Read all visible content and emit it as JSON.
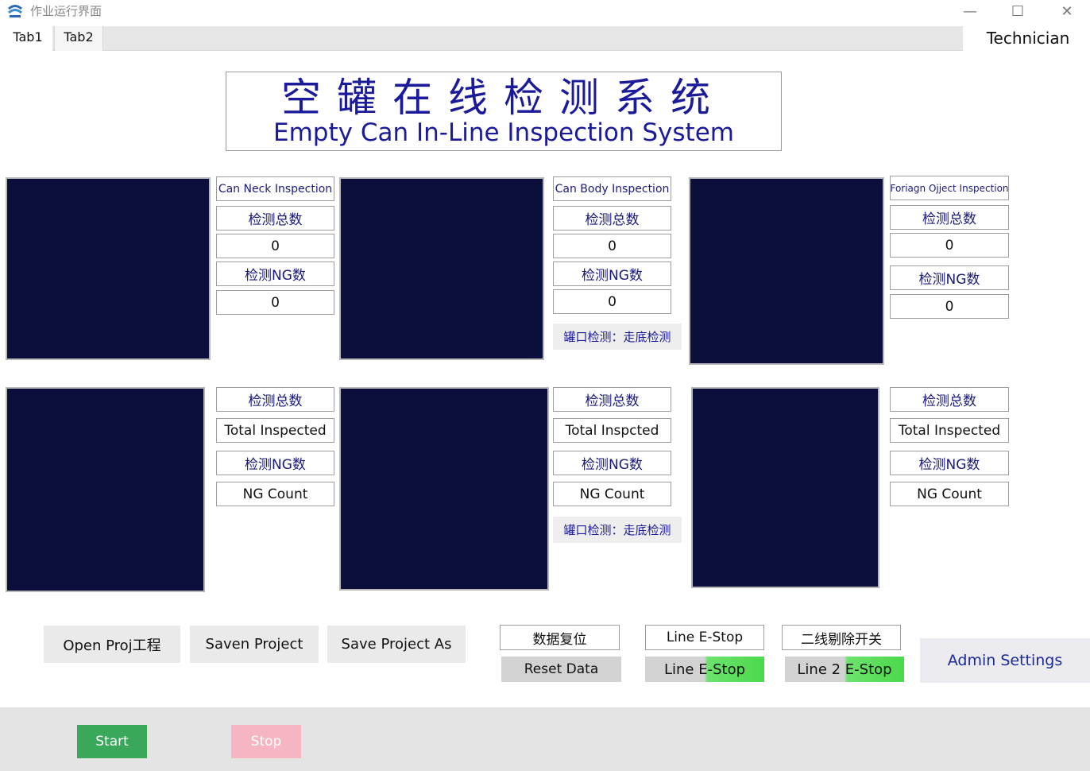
{
  "window": {
    "title": "作业运行界面",
    "minimize": "—",
    "maximize": "☐",
    "close": "✕"
  },
  "tabs": [
    "Tab1",
    "Tab2"
  ],
  "role": "Technician",
  "system_title": {
    "cn": "空罐在线检测系统",
    "en": "Empty Can In-Line Inspection System"
  },
  "top_row": [
    {
      "header": "Can Neck Inspection",
      "total_label": "检测总数",
      "total_value": "0",
      "ng_label": "检测NG数",
      "ng_value": "0"
    },
    {
      "header": "Can Body Inspection",
      "total_label": "检测总数",
      "total_value": "0",
      "ng_label": "检测NG数",
      "ng_value": "0",
      "mode": "罐口检测：走底检测"
    },
    {
      "header": "Foriagn Ojject Inspection",
      "total_label": "检测总数",
      "total_value": "0",
      "ng_label": "检测NG数",
      "ng_value": "0"
    }
  ],
  "bottom_row": [
    {
      "total_label": "检测总数",
      "total_value": "Total Inspected",
      "ng_label": "检测NG数",
      "ng_value": "NG Count"
    },
    {
      "total_label": "检测总数",
      "total_value": "Total Inspcted",
      "ng_label": "检测NG数",
      "ng_value": "NG Count",
      "mode": "罐口检测：走底检测"
    },
    {
      "total_label": "检测总数",
      "total_value": "Total Inspected",
      "ng_label": "检测NG数",
      "ng_value": "NG Count"
    }
  ],
  "project_buttons": {
    "open": "Open Proj工程",
    "save": "Saven Project",
    "save_as": "Save Project As"
  },
  "controls": {
    "data_reset_cn": "数据复位",
    "reset_data": "Reset Data",
    "line_estop_label": "Line E-Stop",
    "line_estop_btn": "Line E-Stop",
    "line2_switch_cn": "二线剔除开关",
    "line2_estop_btn": "Line 2 E-Stop",
    "admin": "Admin Settings"
  },
  "footer": {
    "start": "Start",
    "stop": "Stop"
  },
  "colors": {
    "view_bg": "#0c0f3c",
    "title_blue": "#1a1a9a",
    "start_green": "#39a85a",
    "stop_pink": "#f5b5c3",
    "estop_green": "#4bd94b"
  }
}
